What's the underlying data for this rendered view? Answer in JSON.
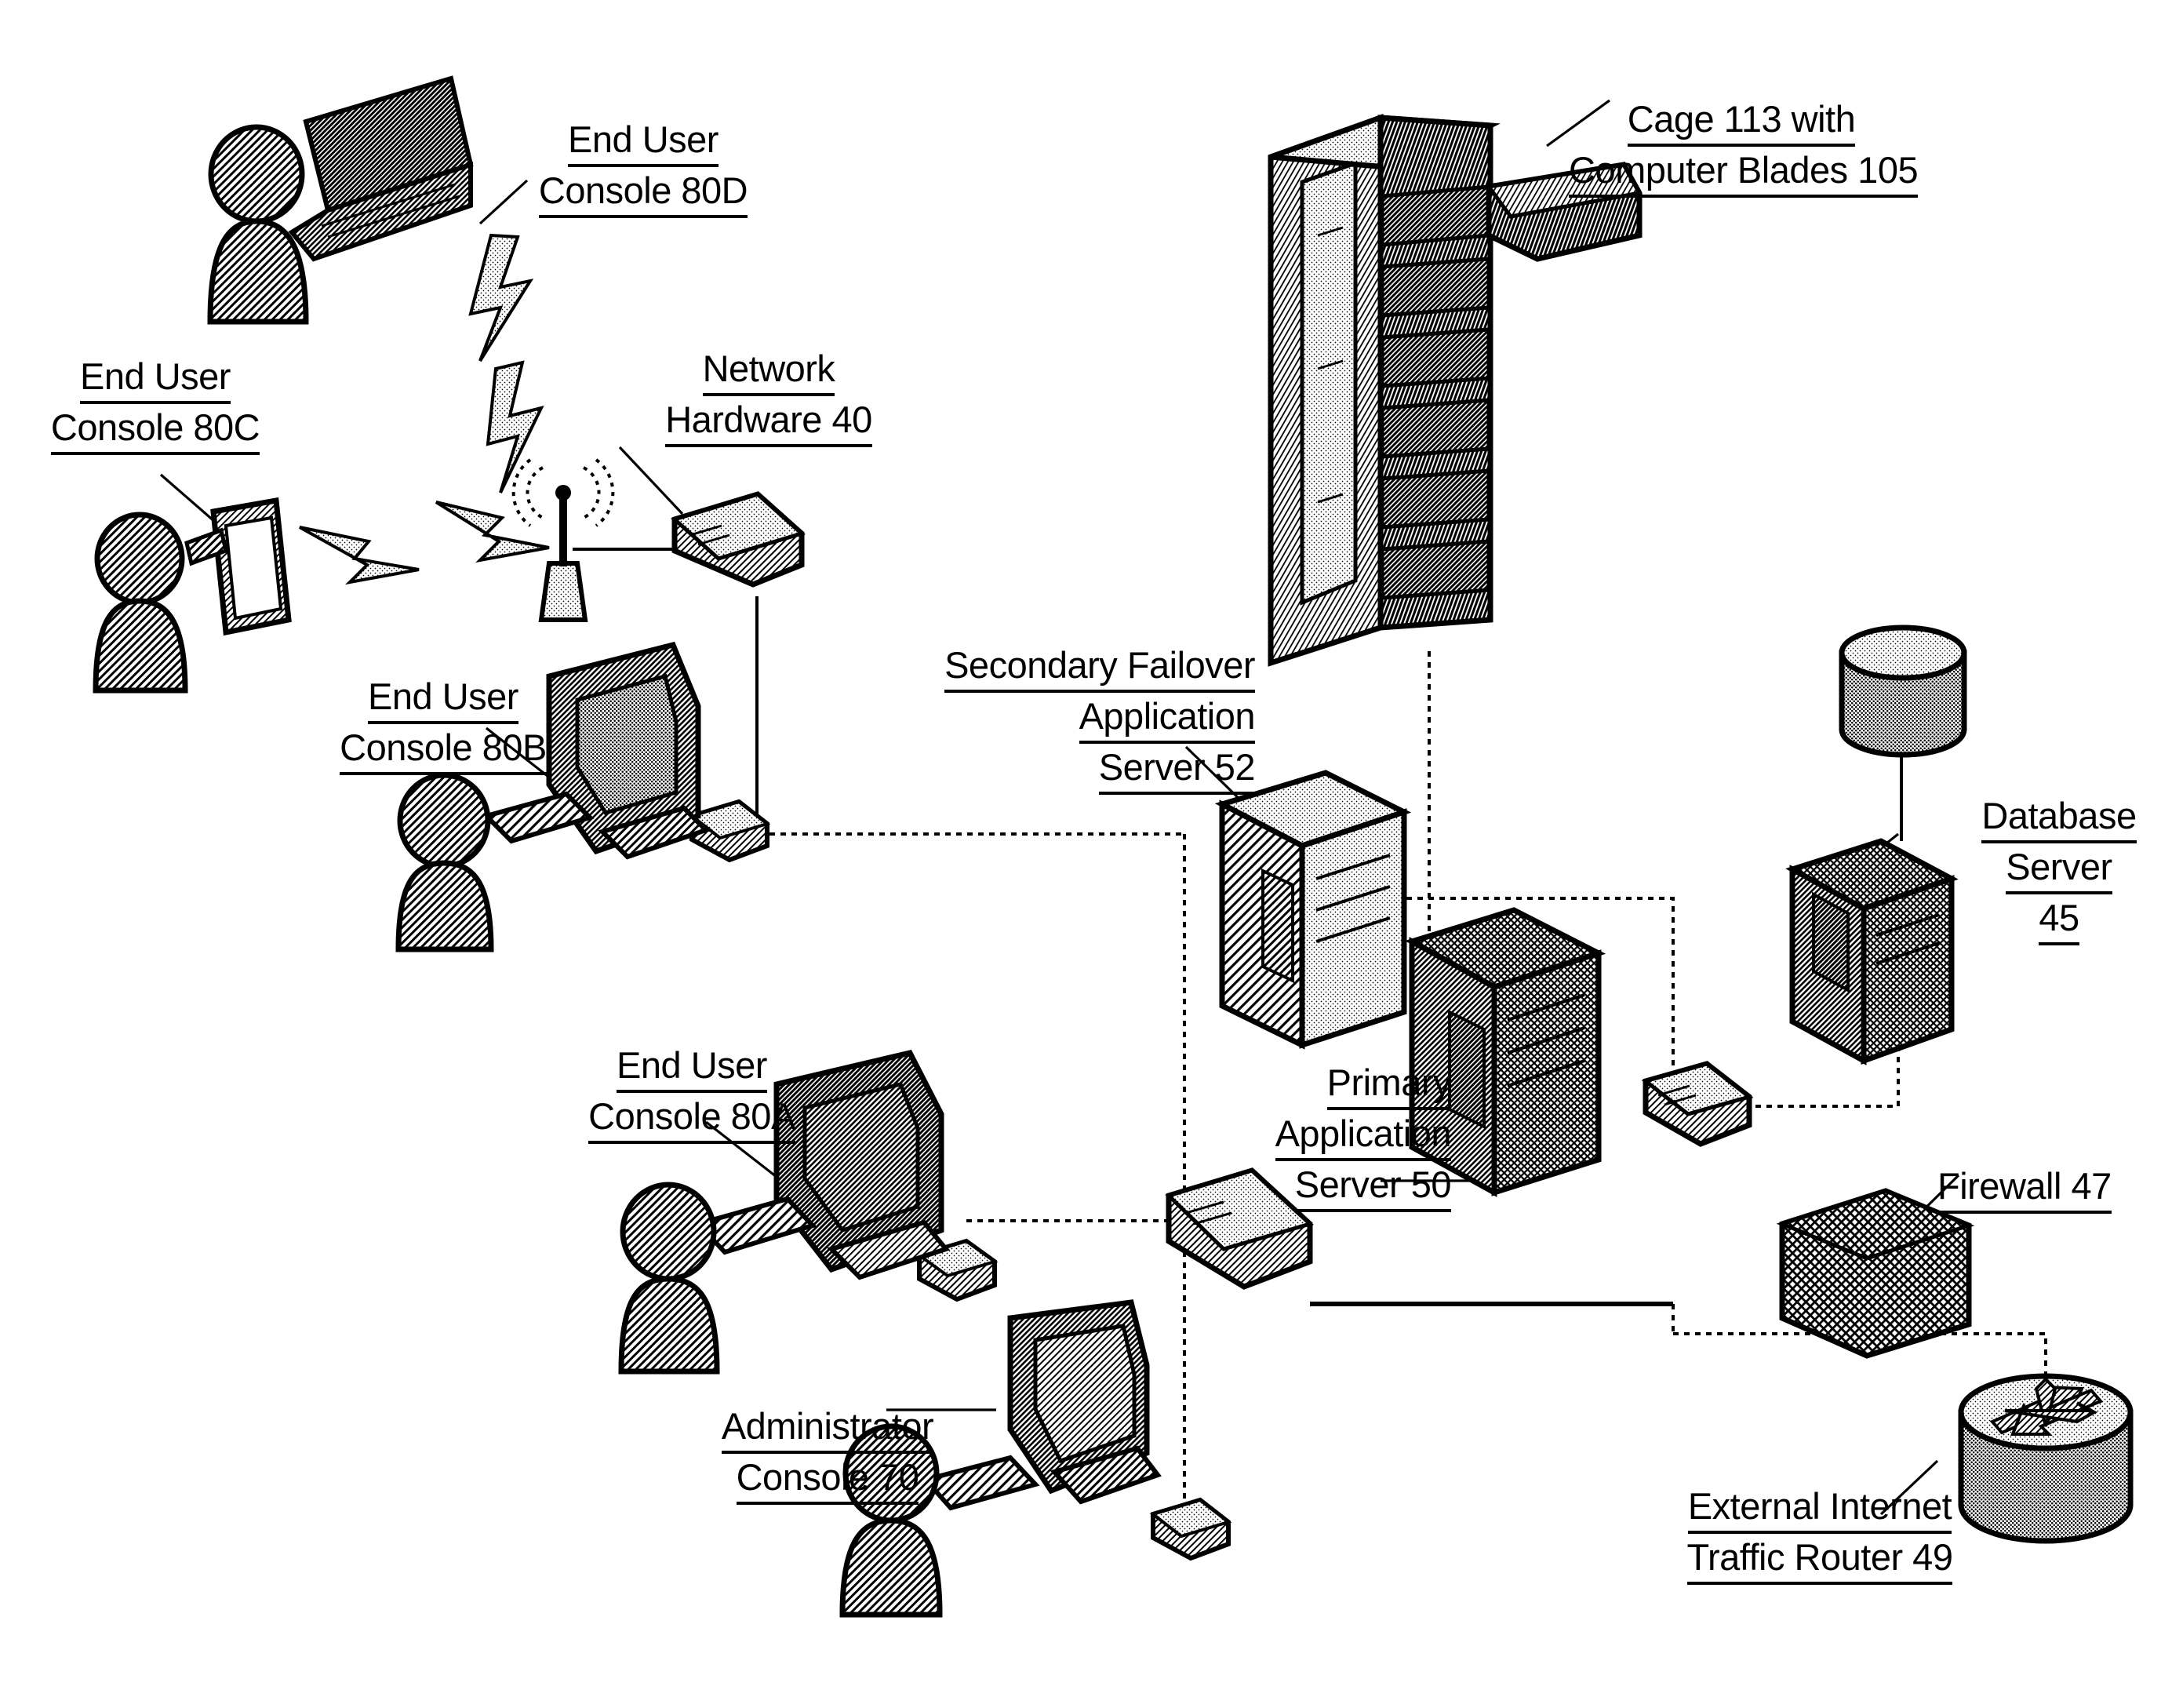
{
  "figure": {
    "type": "patent-network-architecture-diagram",
    "background_color": "#ffffff",
    "ink_color": "#000000"
  },
  "labels": {
    "end_user_console_80d": {
      "lines": [
        "End User",
        "Console 80D"
      ]
    },
    "end_user_console_80c": {
      "lines": [
        "End User",
        "Console 80C"
      ]
    },
    "end_user_console_80b": {
      "lines": [
        "End User",
        "Console 80B"
      ]
    },
    "end_user_console_80a": {
      "lines": [
        "End User",
        "Console 80A"
      ]
    },
    "administrator_console_70": {
      "lines": [
        "Administrator",
        "Console 70"
      ]
    },
    "network_hardware_40": {
      "lines": [
        "Network",
        "Hardware 40"
      ]
    },
    "cage_113": {
      "lines": [
        "Cage 113 with",
        "Computer Blades 105"
      ]
    },
    "secondary_failover_application_server_52": {
      "lines": [
        "Secondary Failover",
        "Application",
        "Server 52"
      ]
    },
    "primary_application_server_50": {
      "lines": [
        "Primary",
        "Application",
        "Server 50"
      ]
    },
    "database_server_45": {
      "lines": [
        "Database",
        "Server",
        "45"
      ]
    },
    "firewall_47": {
      "lines": [
        "Firewall 47"
      ]
    },
    "external_internet_traffic_router_49": {
      "lines": [
        "External Internet",
        "Traffic Router 49"
      ]
    }
  },
  "nodes": [
    {
      "id": "end-user-console-80d",
      "kind": "user-with-laptop",
      "ref": "80D"
    },
    {
      "id": "end-user-console-80c",
      "kind": "user-with-tablet",
      "ref": "80C"
    },
    {
      "id": "end-user-console-80b",
      "kind": "user-with-desktop",
      "ref": "80B"
    },
    {
      "id": "end-user-console-80a",
      "kind": "user-with-desktop",
      "ref": "80A"
    },
    {
      "id": "administrator-console-70",
      "kind": "user-with-desktop",
      "ref": "70"
    },
    {
      "id": "wireless-access-point",
      "kind": "antenna",
      "ref": ""
    },
    {
      "id": "network-hardware-40",
      "kind": "network-switch",
      "ref": "40"
    },
    {
      "id": "cage-113",
      "kind": "blade-rack",
      "ref": "113"
    },
    {
      "id": "secondary-failover-application-server-52",
      "kind": "tower-server",
      "ref": "52"
    },
    {
      "id": "primary-application-server-50",
      "kind": "tower-server",
      "ref": "50"
    },
    {
      "id": "database-server-45",
      "kind": "tower-server-with-disk",
      "ref": "45"
    },
    {
      "id": "firewall-47",
      "kind": "brick-wall-slab",
      "ref": "47"
    },
    {
      "id": "external-internet-traffic-router-49",
      "kind": "router-cylinder",
      "ref": "49"
    },
    {
      "id": "switch-center",
      "kind": "network-switch",
      "ref": ""
    },
    {
      "id": "switch-right",
      "kind": "network-switch",
      "ref": ""
    },
    {
      "id": "switch-80b",
      "kind": "network-switch",
      "ref": ""
    },
    {
      "id": "switch-80a",
      "kind": "network-switch",
      "ref": ""
    },
    {
      "id": "switch-70",
      "kind": "network-switch",
      "ref": ""
    }
  ],
  "connections": [
    {
      "from": "end-user-console-80d",
      "to": "wireless-access-point",
      "style": "lightning"
    },
    {
      "from": "end-user-console-80c",
      "to": "wireless-access-point",
      "style": "lightning"
    },
    {
      "from": "wireless-access-point",
      "to": "network-hardware-40",
      "style": "solid"
    },
    {
      "from": "network-hardware-40",
      "to": "switch-80b",
      "style": "dotted"
    },
    {
      "from": "switch-80b",
      "to": "switch-center",
      "style": "dotted"
    },
    {
      "from": "switch-80a",
      "to": "switch-center",
      "style": "dotted"
    },
    {
      "from": "switch-70",
      "to": "switch-center",
      "style": "dotted"
    },
    {
      "from": "cage-113",
      "to": "primary-application-server-50",
      "style": "dotted"
    },
    {
      "from": "secondary-failover-application-server-52",
      "to": "switch-right",
      "style": "dotted"
    },
    {
      "from": "switch-center",
      "to": "switch-right",
      "style": "solid"
    },
    {
      "from": "switch-right",
      "to": "database-server-45",
      "style": "dotted"
    },
    {
      "from": "database-server-45",
      "to": "firewall-47",
      "style": "dotted"
    },
    {
      "from": "firewall-47",
      "to": "external-internet-traffic-router-49",
      "style": "dotted"
    }
  ]
}
